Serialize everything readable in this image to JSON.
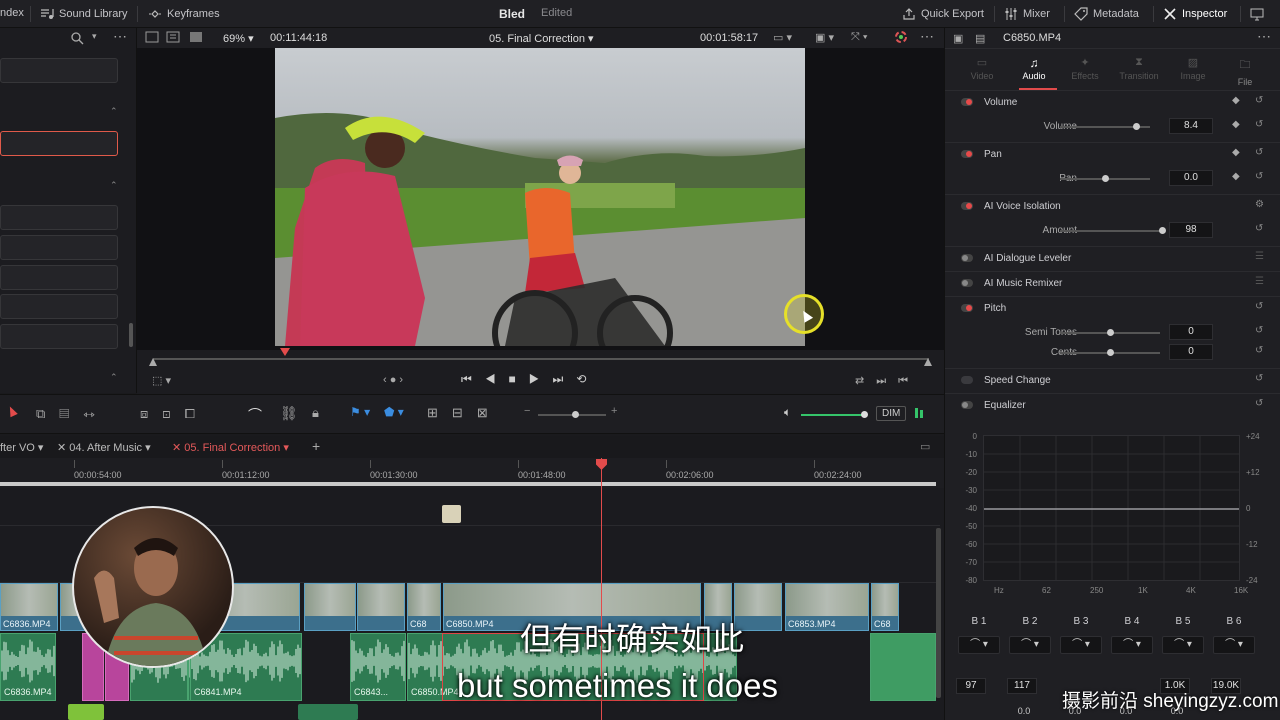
{
  "topbar": {
    "index_label": "ndex",
    "sound_library": "Sound Library",
    "keyframes": "Keyframes",
    "project_name": "Bled",
    "project_status": "Edited",
    "quick_export": "Quick Export",
    "mixer": "Mixer",
    "metadata": "Metadata",
    "inspector": "Inspector"
  },
  "viewer": {
    "zoom": "69%",
    "timecode_left": "00:11:44:18",
    "timeline_name": "05. Final Correction",
    "timecode_right": "00:01:58:17",
    "playhead_fraction": 0.17
  },
  "timeline": {
    "tabs": [
      {
        "label": "fter VO"
      },
      {
        "label": "04. After Music"
      },
      {
        "label": "05. Final Correction"
      }
    ],
    "ruler_ticks": [
      "00:00:54:00",
      "00:01:12:00",
      "00:01:30:00",
      "00:01:48:00",
      "00:02:06:00",
      "00:02:24:00"
    ],
    "dim_label": "DIM",
    "video_clips": [
      "C6836.MP4",
      "",
      "",
      "4",
      "",
      "",
      "C68",
      "C6850.MP4",
      "",
      "",
      "C6853.MP4",
      "C68"
    ],
    "audio_clips": [
      "C6836.MP4",
      "",
      "C684...",
      "C6841.MP4",
      "C6843...",
      "C6850.MP4"
    ]
  },
  "subtitles": {
    "chinese": "但有时确实如此",
    "english": "but sometimes it does"
  },
  "watermark": "摄影前沿 sheyingzyz.com",
  "inspector": {
    "clip_name": "C6850.MP4",
    "tabs": [
      "Video",
      "Audio",
      "Effects",
      "Transition",
      "Image",
      "File"
    ],
    "active_tab": "Audio",
    "volume": {
      "title": "Volume",
      "label": "Volume",
      "value": "8.4",
      "fraction": 0.85
    },
    "pan": {
      "title": "Pan",
      "label": "Pan",
      "value": "0.0",
      "fraction": 0.5
    },
    "voice_isolation": {
      "title": "AI Voice Isolation",
      "label": "Amount",
      "value": "98",
      "fraction": 0.98
    },
    "dialogue_leveler": "AI Dialogue Leveler",
    "music_remixer": "AI Music Remixer",
    "pitch": {
      "title": "Pitch",
      "semitones_label": "Semi Tones",
      "semitones_value": "0",
      "semitones_fraction": 0.5,
      "cents_label": "Cents",
      "cents_value": "0",
      "cents_fraction": 0.5
    },
    "speed_change": "Speed Change",
    "equalizer": {
      "title": "Equalizer",
      "left_scale": [
        "0",
        "-10",
        "-20",
        "-30",
        "-40",
        "-50",
        "-60",
        "-70",
        "-80"
      ],
      "right_scale": [
        "+24",
        "+12",
        "0",
        "-12",
        "-24"
      ],
      "freq": [
        "Hz",
        "62",
        "250",
        "1K",
        "4K",
        "16K"
      ],
      "bands": [
        {
          "name": "B 1",
          "freq": "97",
          "gain": ""
        },
        {
          "name": "B 2",
          "freq": "117",
          "gain": "0.0"
        },
        {
          "name": "B 3",
          "freq": "",
          "gain": "0.0"
        },
        {
          "name": "B 4",
          "freq": "",
          "gain": "0.0"
        },
        {
          "name": "B 5",
          "freq": "1.0K",
          "gain": "0.0"
        },
        {
          "name": "B 6",
          "freq": "19.0K",
          "gain": ""
        }
      ]
    }
  }
}
